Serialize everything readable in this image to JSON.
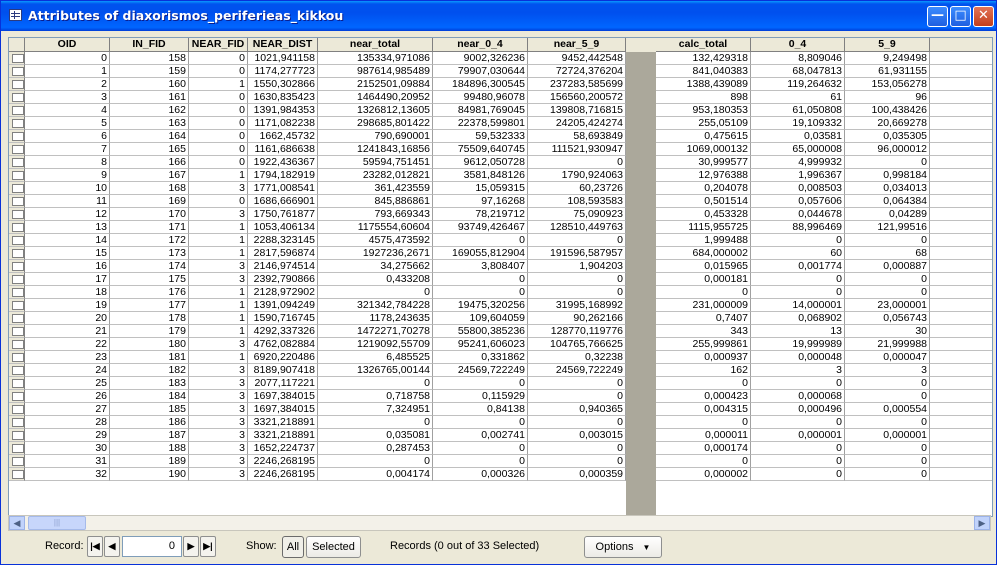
{
  "window": {
    "title": "Attributes of diaxorismos_periferieas_kikkou"
  },
  "columns": [
    {
      "key": "oid",
      "label": "OID"
    },
    {
      "key": "in_fid",
      "label": "IN_FID"
    },
    {
      "key": "near_fid",
      "label": "NEAR_FID"
    },
    {
      "key": "near_dist",
      "label": "NEAR_DIST"
    },
    {
      "key": "near_total",
      "label": "near_total"
    },
    {
      "key": "near_0_4",
      "label": "near_0_4"
    },
    {
      "key": "near_5_9",
      "label": "near_5_9"
    },
    {
      "key": "calc_total",
      "label": "calc_total"
    },
    {
      "key": "c0_4",
      "label": "0_4"
    },
    {
      "key": "c5_9",
      "label": "5_9"
    }
  ],
  "rows": [
    [
      "0",
      "158",
      "0",
      "1021,941158",
      "135334,971086",
      "9002,326236",
      "9452,442548",
      "132,429318",
      "8,809046",
      "9,249498"
    ],
    [
      "1",
      "159",
      "0",
      "1174,277723",
      "987614,985489",
      "79907,030644",
      "72724,376204",
      "841,040383",
      "68,047813",
      "61,931155"
    ],
    [
      "2",
      "160",
      "1",
      "1550,302866",
      "2152501,09884",
      "184896,300545",
      "237283,585699",
      "1388,439089",
      "119,264632",
      "153,056278"
    ],
    [
      "3",
      "161",
      "0",
      "1630,835423",
      "1464490,20952",
      "99480,96078",
      "156560,200572",
      "898",
      "61",
      "96"
    ],
    [
      "4",
      "162",
      "0",
      "1391,984353",
      "1326812,13605",
      "84981,769045",
      "139808,716815",
      "953,180353",
      "61,050808",
      "100,438426"
    ],
    [
      "5",
      "163",
      "0",
      "1171,082238",
      "298685,801422",
      "22378,599801",
      "24205,424274",
      "255,05109",
      "19,109332",
      "20,669278"
    ],
    [
      "6",
      "164",
      "0",
      "1662,45732",
      "790,690001",
      "59,532333",
      "58,693849",
      "0,475615",
      "0,03581",
      "0,035305"
    ],
    [
      "7",
      "165",
      "0",
      "1161,686638",
      "1241843,16856",
      "75509,640745",
      "111521,930947",
      "1069,000132",
      "65,000008",
      "96,000012"
    ],
    [
      "8",
      "166",
      "0",
      "1922,436367",
      "59594,751451",
      "9612,050728",
      "0",
      "30,999577",
      "4,999932",
      "0"
    ],
    [
      "9",
      "167",
      "1",
      "1794,182919",
      "23282,012821",
      "3581,848126",
      "1790,924063",
      "12,976388",
      "1,996367",
      "0,998184"
    ],
    [
      "10",
      "168",
      "3",
      "1771,008541",
      "361,423559",
      "15,059315",
      "60,23726",
      "0,204078",
      "0,008503",
      "0,034013"
    ],
    [
      "11",
      "169",
      "0",
      "1686,666901",
      "845,886861",
      "97,16268",
      "108,593583",
      "0,501514",
      "0,057606",
      "0,064384"
    ],
    [
      "12",
      "170",
      "3",
      "1750,761877",
      "793,669343",
      "78,219712",
      "75,090923",
      "0,453328",
      "0,044678",
      "0,04289"
    ],
    [
      "13",
      "171",
      "1",
      "1053,406134",
      "1175554,60604",
      "93749,426467",
      "128510,449763",
      "1115,955725",
      "88,996469",
      "121,99516"
    ],
    [
      "14",
      "172",
      "1",
      "2288,323145",
      "4575,473592",
      "0",
      "0",
      "1,999488",
      "0",
      "0"
    ],
    [
      "15",
      "173",
      "1",
      "2817,596874",
      "1927236,2671",
      "169055,812904",
      "191596,587957",
      "684,000002",
      "60",
      "68"
    ],
    [
      "16",
      "174",
      "3",
      "2146,974514",
      "34,275662",
      "3,808407",
      "1,904203",
      "0,015965",
      "0,001774",
      "0,000887"
    ],
    [
      "17",
      "175",
      "3",
      "2392,790866",
      "0,433208",
      "0",
      "0",
      "0,000181",
      "0",
      "0"
    ],
    [
      "18",
      "176",
      "1",
      "2128,972902",
      "0",
      "0",
      "0",
      "0",
      "0",
      "0"
    ],
    [
      "19",
      "177",
      "1",
      "1391,094249",
      "321342,784228",
      "19475,320256",
      "31995,168992",
      "231,000009",
      "14,000001",
      "23,000001"
    ],
    [
      "20",
      "178",
      "1",
      "1590,716745",
      "1178,243635",
      "109,604059",
      "90,262166",
      "0,7407",
      "0,068902",
      "0,056743"
    ],
    [
      "21",
      "179",
      "1",
      "4292,337326",
      "1472271,70278",
      "55800,385236",
      "128770,119776",
      "343",
      "13",
      "30"
    ],
    [
      "22",
      "180",
      "3",
      "4762,082884",
      "1219092,55709",
      "95241,606023",
      "104765,766625",
      "255,999861",
      "19,999989",
      "21,999988"
    ],
    [
      "23",
      "181",
      "1",
      "6920,220486",
      "6,485525",
      "0,331862",
      "0,32238",
      "0,000937",
      "0,000048",
      "0,000047"
    ],
    [
      "24",
      "182",
      "3",
      "8189,907418",
      "1326765,00144",
      "24569,722249",
      "24569,722249",
      "162",
      "3",
      "3"
    ],
    [
      "25",
      "183",
      "3",
      "2077,117221",
      "0",
      "0",
      "0",
      "0",
      "0",
      "0"
    ],
    [
      "26",
      "184",
      "3",
      "1697,384015",
      "0,718758",
      "0,115929",
      "0",
      "0,000423",
      "0,000068",
      "0"
    ],
    [
      "27",
      "185",
      "3",
      "1697,384015",
      "7,324951",
      "0,84138",
      "0,940365",
      "0,004315",
      "0,000496",
      "0,000554"
    ],
    [
      "28",
      "186",
      "3",
      "3321,218891",
      "0",
      "0",
      "0",
      "0",
      "0",
      "0"
    ],
    [
      "29",
      "187",
      "3",
      "3321,218891",
      "0,035081",
      "0,002741",
      "0,003015",
      "0,000011",
      "0,000001",
      "0,000001"
    ],
    [
      "30",
      "188",
      "3",
      "1652,224737",
      "0,287453",
      "0",
      "0",
      "0,000174",
      "0",
      "0"
    ],
    [
      "31",
      "189",
      "3",
      "2246,268195",
      "0",
      "0",
      "0",
      "0",
      "0",
      "0"
    ],
    [
      "32",
      "190",
      "3",
      "2246,268195",
      "0,004174",
      "0,000326",
      "0,000359",
      "0,000002",
      "0",
      "0"
    ]
  ],
  "footer": {
    "record_label": "Record:",
    "record_value": "0",
    "show_label": "Show:",
    "all_label": "All",
    "selected_label": "Selected",
    "status": "Records (0 out of 33 Selected)",
    "options_label": "Options"
  },
  "icons": {
    "window": "table-icon",
    "minimize": "minimize-icon",
    "maximize": "maximize-icon",
    "close": "close-icon"
  }
}
